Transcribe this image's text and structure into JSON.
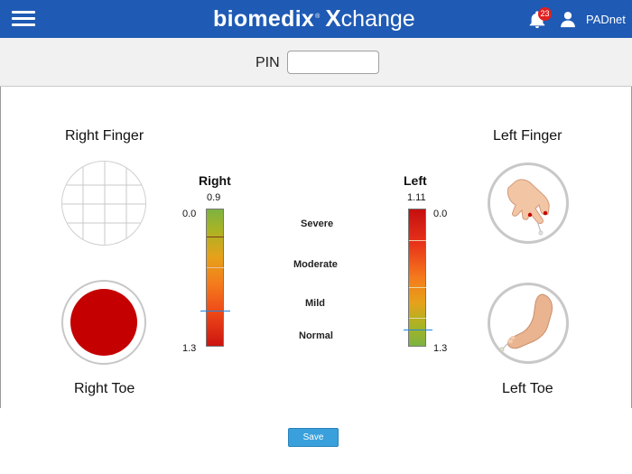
{
  "header": {
    "brand_primary": "biomedix",
    "brand_registered": "®",
    "brand_x": "X",
    "brand_secondary": "change",
    "notification_count": "23",
    "user_name": "PADnet",
    "bar_color": "#1f5ab4"
  },
  "pin": {
    "label": "PIN",
    "value": "",
    "placeholder": ""
  },
  "sites": {
    "right_finger": "Right Finger",
    "right_toe": "Right Toe",
    "left_finger": "Left Finger",
    "left_toe": "Left Toe"
  },
  "scales": {
    "right": {
      "title": "Right",
      "value": "0.9",
      "top_label": "0.0",
      "bottom_label": "1.3"
    },
    "left": {
      "title": "Left",
      "value": "1.11",
      "top_label": "0.0",
      "bottom_label": "1.3"
    }
  },
  "severity_labels": [
    "Severe",
    "Moderate",
    "Mild",
    "Normal"
  ],
  "right_toe_color": "#c40000",
  "marker_color": "#1e88e5",
  "save_label": "Save"
}
